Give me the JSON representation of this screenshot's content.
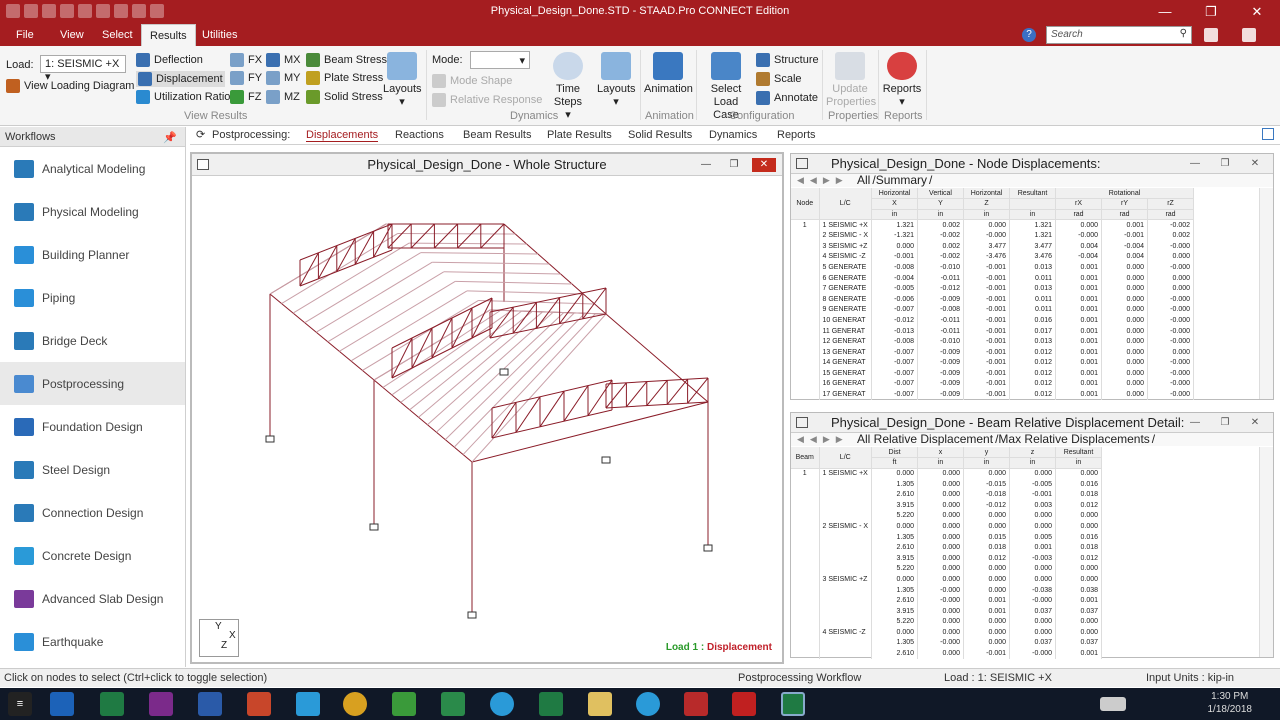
{
  "app": {
    "title": "Physical_Design_Done.STD - STAAD.Pro CONNECT Edition"
  },
  "menu": {
    "file": "File",
    "view": "View",
    "select": "Select",
    "results": "Results",
    "utilities": "Utilities",
    "search_placeholder": "Search",
    "search_icon": "magnifier-icon"
  },
  "ribbon": {
    "load_label": "Load:",
    "load_value": "1: SEISMIC +X",
    "view_loading": "View Loading Diagram",
    "deflection": "Deflection",
    "displacement": "Displacement",
    "utilization": "Utilization Ratio",
    "fx": "FX",
    "fy": "FY",
    "fz": "FZ",
    "mx": "MX",
    "my": "MY",
    "mz": "MZ",
    "beam_stress": "Beam Stress",
    "plate_stress": "Plate Stress",
    "solid_stress": "Solid Stress",
    "layouts": "Layouts",
    "view_results": "View Results",
    "mode_label": "Mode:",
    "mode_shape": "Mode Shape",
    "relative_response": "Relative Response",
    "time_steps": "Time Steps",
    "layouts2": "Layouts",
    "dynamics": "Dynamics",
    "animation": "Animation",
    "animation_grp": "Animation",
    "select_load_case_1": "Select",
    "select_load_case_2": "Load Case",
    "structure": "Structure",
    "scale": "Scale",
    "annotate": "Annotate",
    "configuration": "Configuration",
    "update_1": "Update",
    "update_2": "Properties",
    "properties": "Properties",
    "reports": "Reports",
    "reports_grp": "Reports"
  },
  "subtabs": {
    "postprocessing": "Postprocessing:",
    "displacements": "Displacements",
    "reactions": "Reactions",
    "beam_results": "Beam Results",
    "plate_results": "Plate Results",
    "solid_results": "Solid Results",
    "dynamics": "Dynamics",
    "reports": "Reports"
  },
  "workflows": {
    "title": "Workflows",
    "pin": "ⅰ",
    "items": [
      {
        "label": "Analytical Modeling",
        "color": "#2a7ab8"
      },
      {
        "label": "Physical Modeling",
        "color": "#2a7ab8"
      },
      {
        "label": "Building Planner",
        "color": "#2a8fd8"
      },
      {
        "label": "Piping",
        "color": "#2a8fd8"
      },
      {
        "label": "Bridge Deck",
        "color": "#2a7ab8"
      },
      {
        "label": "Postprocessing",
        "color": "#4a8ad0"
      },
      {
        "label": "Foundation Design",
        "color": "#2a6ab8"
      },
      {
        "label": "Steel Design",
        "color": "#2a7ab8"
      },
      {
        "label": "Connection Design",
        "color": "#2a7ab8"
      },
      {
        "label": "Concrete Design",
        "color": "#2a9ad8"
      },
      {
        "label": "Advanced Slab Design",
        "color": "#7a3a9a"
      },
      {
        "label": "Earthquake",
        "color": "#2a8fd8"
      }
    ]
  },
  "view": {
    "title": "Physical_Design_Done - Whole Structure",
    "axis_y": "Y",
    "axis_x": "X",
    "axis_z": "Z",
    "load_prefix": "Load 1 : ",
    "load_type": "Displacement"
  },
  "nodes": {
    "title": "Physical_Design_Done - Node Displacements:",
    "tab_all": "All",
    "tab_summary": "Summary",
    "headers": {
      "node": "Node",
      "lc": "L/C",
      "h1": "Horizontal",
      "v": "Vertical",
      "h2": "Horizontal",
      "res": "Resultant",
      "rot": "Rotational",
      "x": "X",
      "y": "Y",
      "z": "Z",
      "rx": "rX",
      "ry": "rY",
      "rz": "rZ",
      "in": "in",
      "rad": "rad"
    },
    "rows": [
      [
        "1",
        "1 SEISMIC +X",
        "1.321",
        "0.002",
        "0.000",
        "1.321",
        "0.000",
        "0.001",
        "-0.002"
      ],
      [
        "",
        "2 SEISMIC - X",
        "-1.321",
        "-0.002",
        "-0.000",
        "1.321",
        "-0.000",
        "-0.001",
        "0.002"
      ],
      [
        "",
        "3 SEISMIC +Z",
        "0.000",
        "0.002",
        "3.477",
        "3.477",
        "0.004",
        "-0.004",
        "-0.000"
      ],
      [
        "",
        "4 SEISMIC -Z",
        "-0.001",
        "-0.002",
        "-3.476",
        "3.476",
        "-0.004",
        "0.004",
        "0.000"
      ],
      [
        "",
        "5 GENERATE",
        "-0.008",
        "-0.010",
        "-0.001",
        "0.013",
        "0.001",
        "0.000",
        "-0.000"
      ],
      [
        "",
        "6 GENERATE",
        "-0.004",
        "-0.011",
        "-0.001",
        "0.011",
        "0.001",
        "0.000",
        "0.000"
      ],
      [
        "",
        "7 GENERATE",
        "-0.005",
        "-0.012",
        "-0.001",
        "0.013",
        "0.001",
        "0.000",
        "0.000"
      ],
      [
        "",
        "8 GENERATE",
        "-0.006",
        "-0.009",
        "-0.001",
        "0.011",
        "0.001",
        "0.000",
        "-0.000"
      ],
      [
        "",
        "9 GENERATE",
        "-0.007",
        "-0.008",
        "-0.001",
        "0.011",
        "0.001",
        "0.000",
        "-0.000"
      ],
      [
        "",
        "10 GENERAT",
        "-0.012",
        "-0.011",
        "-0.001",
        "0.016",
        "0.001",
        "0.000",
        "-0.000"
      ],
      [
        "",
        "11 GENERAT",
        "-0.013",
        "-0.011",
        "-0.001",
        "0.017",
        "0.001",
        "0.000",
        "-0.000"
      ],
      [
        "",
        "12 GENERAT",
        "-0.008",
        "-0.010",
        "-0.001",
        "0.013",
        "0.001",
        "0.000",
        "-0.000"
      ],
      [
        "",
        "13 GENERAT",
        "-0.007",
        "-0.009",
        "-0.001",
        "0.012",
        "0.001",
        "0.000",
        "0.000"
      ],
      [
        "",
        "14 GENERAT",
        "-0.007",
        "-0.009",
        "-0.001",
        "0.012",
        "0.001",
        "0.000",
        "-0.000"
      ],
      [
        "",
        "15 GENERAT",
        "-0.007",
        "-0.009",
        "-0.001",
        "0.012",
        "0.001",
        "0.000",
        "-0.000"
      ],
      [
        "",
        "16 GENERAT",
        "-0.007",
        "-0.009",
        "-0.001",
        "0.012",
        "0.001",
        "0.000",
        "-0.000"
      ],
      [
        "",
        "17 GENERAT",
        "-0.007",
        "-0.009",
        "-0.001",
        "0.012",
        "0.001",
        "0.000",
        "-0.000"
      ]
    ]
  },
  "beams": {
    "title": "Physical_Design_Done - Beam Relative Displacement Detail:",
    "tab_all": "All Relative Displacement",
    "tab_max": "Max Relative Displacements",
    "headers": {
      "beam": "Beam",
      "lc": "L/C",
      "dist": "Dist",
      "ft": "ft",
      "x": "x",
      "y": "y",
      "z": "z",
      "res": "Resultant",
      "in": "in"
    },
    "rows": [
      [
        "1",
        "1 SEISMIC +X",
        "0.000",
        "0.000",
        "0.000",
        "0.000",
        "0.000"
      ],
      [
        "",
        "",
        "1.305",
        "0.000",
        "-0.015",
        "-0.005",
        "0.016"
      ],
      [
        "",
        "",
        "2.610",
        "0.000",
        "-0.018",
        "-0.001",
        "0.018"
      ],
      [
        "",
        "",
        "3.915",
        "0.000",
        "-0.012",
        "0.003",
        "0.012"
      ],
      [
        "",
        "",
        "5.220",
        "0.000",
        "0.000",
        "0.000",
        "0.000"
      ],
      [
        "",
        "2 SEISMIC - X",
        "0.000",
        "0.000",
        "0.000",
        "0.000",
        "0.000"
      ],
      [
        "",
        "",
        "1.305",
        "0.000",
        "0.015",
        "0.005",
        "0.016"
      ],
      [
        "",
        "",
        "2.610",
        "0.000",
        "0.018",
        "0.001",
        "0.018"
      ],
      [
        "",
        "",
        "3.915",
        "0.000",
        "0.012",
        "-0.003",
        "0.012"
      ],
      [
        "",
        "",
        "5.220",
        "0.000",
        "0.000",
        "0.000",
        "0.000"
      ],
      [
        "",
        "3 SEISMIC +Z",
        "0.000",
        "0.000",
        "0.000",
        "0.000",
        "0.000"
      ],
      [
        "",
        "",
        "1.305",
        "-0.000",
        "0.000",
        "-0.038",
        "0.038"
      ],
      [
        "",
        "",
        "2.610",
        "-0.000",
        "0.001",
        "-0.000",
        "0.001"
      ],
      [
        "",
        "",
        "3.915",
        "0.000",
        "0.001",
        "0.037",
        "0.037"
      ],
      [
        "",
        "",
        "5.220",
        "0.000",
        "0.000",
        "0.000",
        "0.000"
      ],
      [
        "",
        "4 SEISMIC -Z",
        "0.000",
        "0.000",
        "0.000",
        "0.000",
        "0.000"
      ],
      [
        "",
        "",
        "1.305",
        "-0.000",
        "0.000",
        "0.037",
        "0.037"
      ],
      [
        "",
        "",
        "2.610",
        "0.000",
        "-0.001",
        "-0.000",
        "0.001"
      ]
    ]
  },
  "status": {
    "left": "Click on nodes to select (Ctrl+click to toggle selection)",
    "workflow": "Postprocessing Workflow",
    "load": "Load : 1: SEISMIC +X",
    "units": "Input Units : kip-in"
  },
  "taskbar": {
    "time": "1:30 PM",
    "date": "1/18/2018"
  }
}
